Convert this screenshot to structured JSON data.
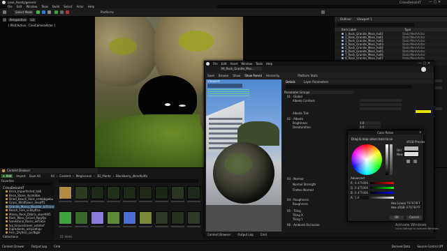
{
  "main": {
    "window_title": "CrimeDetroit4T",
    "tab": "cave_Assets/generic",
    "menus": [
      "File",
      "Edit",
      "Window",
      "Tools",
      "Build",
      "Select",
      "Actor",
      "Help"
    ],
    "toolbar": {
      "mode": "Select Mode",
      "platforms": "Platforms"
    },
    "viewport": {
      "perspective": "Perspective",
      "lit": "Lit",
      "pilot_label": "[ Pilot Active - CineCameraActor ]"
    },
    "outliner": {
      "tab1": "Outliner",
      "tab2": "Viewport 1",
      "header_label": "Item Label",
      "header_type": "Type",
      "rows": [
        "1_Rock_Granite_Moss_holl1",
        "2_Rock_Granite_Moss_holl1",
        "3_Rock_Granite_Moss_holl2",
        "4_Rock_Granite_Moss_holl3",
        "5_Rock_Granite_Moss_holl4",
        "6_Rock_Granite_Moss_holl5",
        "7_Rock_Granite_Moss_holl6",
        "8_Rock_Granite_Moss_holl7"
      ],
      "type": "StaticMeshActor"
    }
  },
  "content_browser": {
    "title": "Content Browser",
    "add": "+ Add",
    "import": "Import",
    "save_all": "Save All",
    "path": [
      "All",
      "Content",
      "Megascans",
      "3D_Plants",
      "Blackberry_dkmdfy4fa"
    ],
    "favorites": "Favorites",
    "project": "CrimeDetroit4T",
    "folders": [
      "Brick_Imperfected_tddi",
      "Brick_Stone_ihcmtdbe",
      "Dried_Beach_Rock_cmkbbgwbu",
      "Grass_Wildflower_deedff1",
      "Granite_Mossy_Boulder_bd1ryvvqc",
      "Beach_Fern_vckbyftna",
      "Mossy_Rock_Debris_xbyefdb5",
      "Rock_Moss_Gravel_ttpjyfjp",
      "Sandstone_Rocks_wlfcebn",
      "Ivy_Groundcover_xsbrbvf",
      "Ingredients_astiyedhqv",
      "Fern_Dryfern_cvcfbgkr"
    ],
    "search_placeholder": "Search Blackberry",
    "collections": "Collections",
    "status": "21 items"
  },
  "material_window": {
    "title": "MI_Rock_Granite_Mos...",
    "menus": [
      "File",
      "Edit",
      "Asset",
      "Window",
      "Tools",
      "Help"
    ],
    "toolbar": [
      "Save",
      "Browse",
      "Show",
      "Show Parent",
      "Hierarchy"
    ],
    "platform_stats": "Platform Stats",
    "viewport_tab": "Viewport",
    "details_tab": "Details",
    "layer_params_tab": "Layer Parameters",
    "search_placeholder": "Search",
    "sections": [
      "Parameter Groups",
      "01 - Global",
      "02 - Albedo",
      "03 - Normal",
      "04 - Roughness",
      "05 - Tiling",
      "06 - Ambient Occlusion",
      "Previewing"
    ],
    "params": [
      "Albedo Controls",
      "Albedo Tint",
      "Brightness",
      "Desaturation",
      "Normal Strength",
      "Flatten Normal",
      "Roughness",
      "Tiling X",
      "Tiling Y"
    ],
    "values": [
      "1.0",
      "0.0",
      "0.475000",
      "0.6",
      "1.0"
    ],
    "bottom_tabs": [
      "Content Browser",
      "Output Log",
      "Cmd"
    ],
    "colors": {
      "albedo_tint": "#e8e600",
      "magenta": "#e000c8"
    }
  },
  "color_picker": {
    "title": "Color Picker",
    "dropdown": "Drag & drop colors here to save",
    "preview_label": "sRGB Preview",
    "old_label": "Old",
    "new_label": "New",
    "advanced": "Advanced",
    "channels": [
      {
        "label": "R",
        "value": "0.475000"
      },
      {
        "label": "G",
        "value": "0.475000"
      },
      {
        "label": "B",
        "value": "0.475000"
      },
      {
        "label": "A",
        "value": "1.0"
      }
    ],
    "hex_linear_label": "Hex Linear",
    "hex_linear": "797979FF",
    "hex_srgb_label": "Hex sRGB",
    "hex_srgb": "B7B7B7FF",
    "ok": "OK",
    "cancel": "Cancel"
  },
  "activate_windows": {
    "title": "Activate Windows",
    "subtitle": "Go to Settings to activate Windows."
  },
  "status_bar": {
    "items": [
      "Content Drawer",
      "Output Log",
      "Cmd"
    ],
    "right": [
      "Derived Data",
      "Source Control Off"
    ]
  }
}
